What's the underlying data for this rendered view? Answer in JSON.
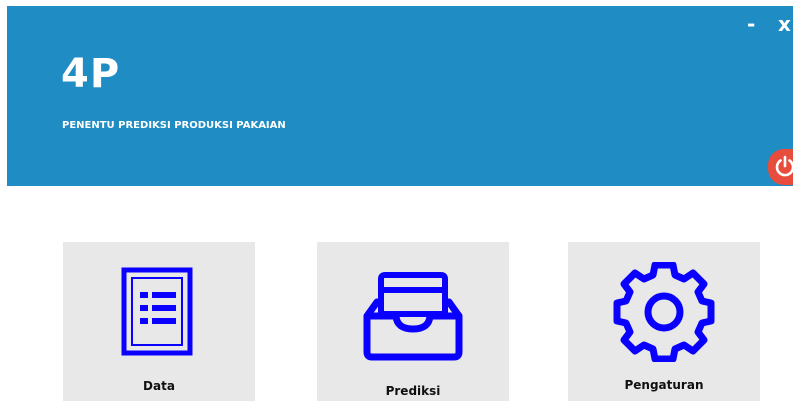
{
  "header": {
    "app_name": "4P",
    "subtitle": "PENENTU PREDIKSI PRODUKSI PAKAIAN",
    "minimize_label": "-",
    "close_label": "x",
    "power_icon": "power-icon",
    "colors": {
      "header_bg": "#1f8dc4",
      "power_bg": "#e74c3c",
      "icon_blue": "#0a00ff",
      "tile_bg": "#e8e8e8"
    }
  },
  "menu": {
    "tiles": [
      {
        "label": "Data",
        "icon": "list-document-icon"
      },
      {
        "label": "Prediksi",
        "icon": "inbox-tray-icon"
      },
      {
        "label": "Pengaturan",
        "icon": "gear-icon"
      }
    ]
  }
}
